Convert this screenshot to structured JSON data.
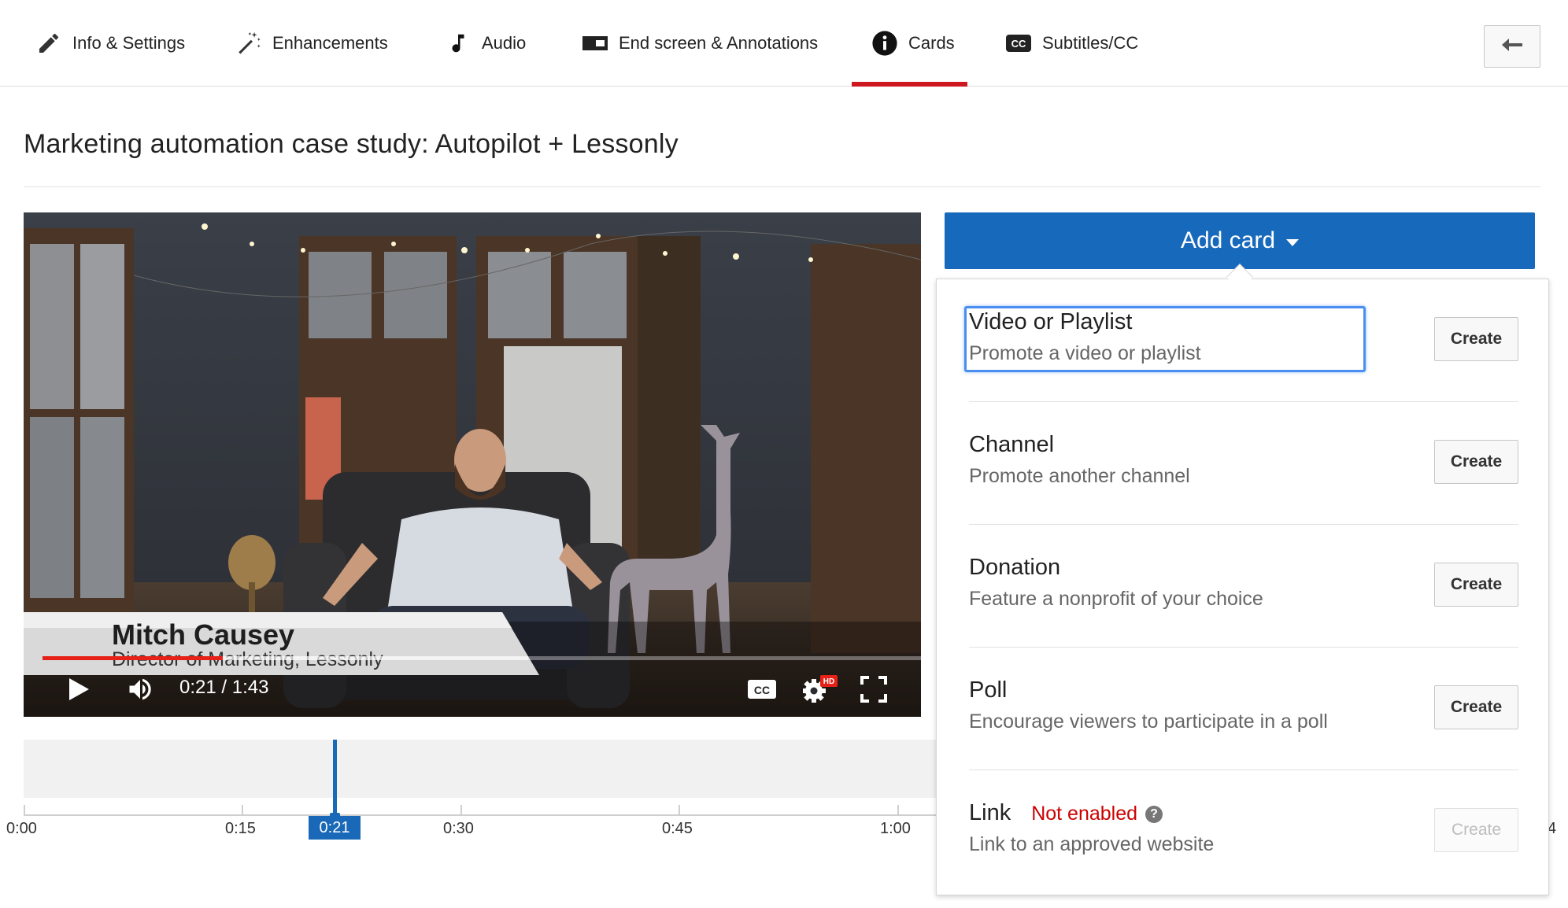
{
  "tabs": [
    {
      "label": "Info & Settings",
      "icon": "pencil-icon",
      "active": false
    },
    {
      "label": "Enhancements",
      "icon": "magic-wand-icon",
      "active": false
    },
    {
      "label": "Audio",
      "icon": "music-note-icon",
      "active": false
    },
    {
      "label": "End screen & Annotations",
      "icon": "end-screen-icon",
      "active": false
    },
    {
      "label": "Cards",
      "icon": "info-icon",
      "active": true
    },
    {
      "label": "Subtitles/CC",
      "icon": "cc-icon",
      "active": false
    }
  ],
  "back_icon": "back-arrow-icon",
  "page_title": "Marketing automation case study: Autopilot + Lessonly",
  "player": {
    "overlay_name": "Mitch Causey",
    "overlay_role": "Director of Marketing, Lessonly",
    "time": "0:21 / 1:43",
    "played_fraction": 0.204,
    "hd_badge": "HD",
    "cc_label": "CC",
    "icons": [
      "play-icon",
      "volume-icon",
      "cc-icon",
      "settings-icon",
      "fullscreen-icon"
    ]
  },
  "timeline": {
    "ticks": [
      "0:00",
      "0:15",
      "0:30",
      "0:45",
      "1:00"
    ],
    "playhead_label": "0:21",
    "clipped_label_fragment": "4"
  },
  "add_card": {
    "label": "Add card",
    "items": [
      {
        "title": "Video or Playlist",
        "desc": "Promote a video or playlist",
        "button": "Create",
        "focused": true,
        "enabled": true
      },
      {
        "title": "Channel",
        "desc": "Promote another channel",
        "button": "Create",
        "enabled": true
      },
      {
        "title": "Donation",
        "desc": "Feature a nonprofit of your choice",
        "button": "Create",
        "enabled": true
      },
      {
        "title": "Poll",
        "desc": "Encourage viewers to participate in a poll",
        "button": "Create",
        "enabled": true
      },
      {
        "title": "Link",
        "status": "Not enabled",
        "help": "?",
        "desc": "Link to an approved website",
        "button": "Create",
        "enabled": false
      }
    ]
  },
  "colors": {
    "accent_blue": "#1669bb",
    "tab_active_underline": "#cc181e",
    "progress_played": "#e62117",
    "status_red": "#cc0000",
    "focus_ring": "#4a8ff0"
  }
}
